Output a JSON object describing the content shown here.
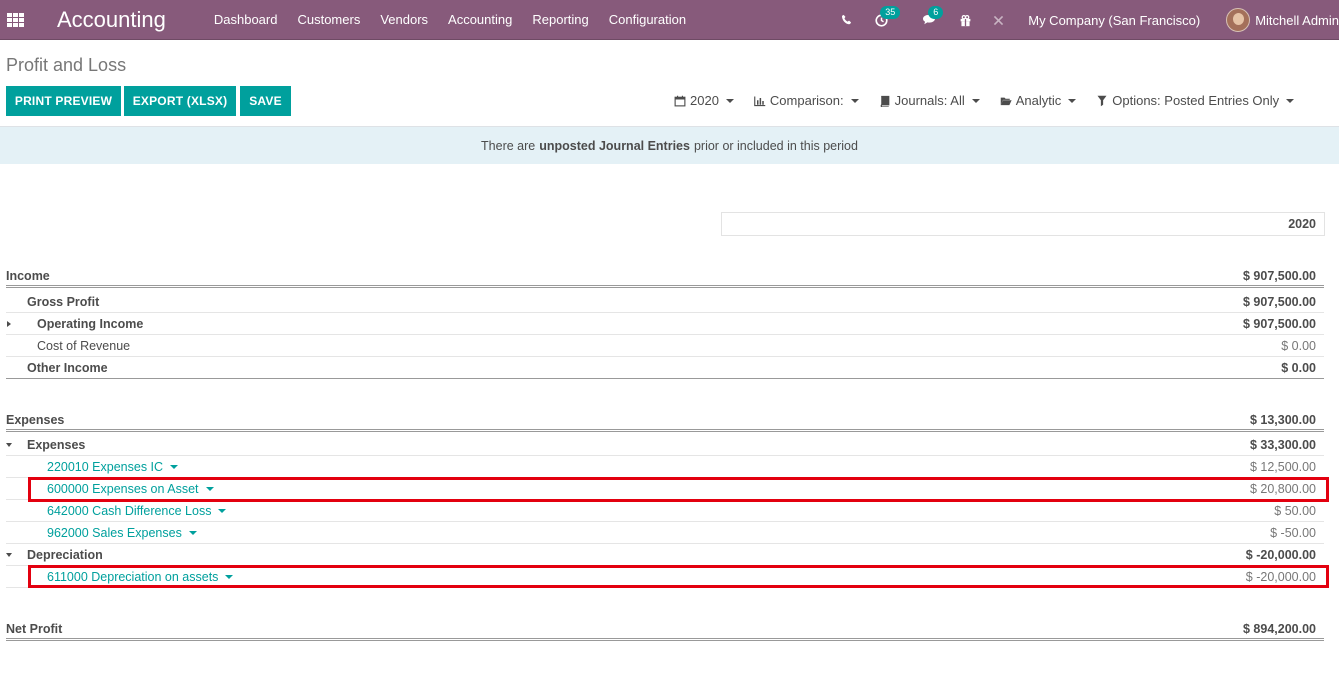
{
  "navbar": {
    "brand": "Accounting",
    "menu": [
      "Dashboard",
      "Customers",
      "Vendors",
      "Accounting",
      "Reporting",
      "Configuration"
    ],
    "activity_badge": "35",
    "messages_badge": "6",
    "company": "My Company (San Francisco)",
    "user": "Mitchell Admin"
  },
  "control_panel": {
    "title": "Profit and Loss",
    "buttons": {
      "print_preview": "PRINT PREVIEW",
      "export": "EXPORT (XLSX)",
      "save": "SAVE"
    },
    "filters": {
      "date": "2020",
      "comparison": "Comparison:",
      "journals": "Journals: All",
      "analytic": "Analytic",
      "options": "Options: Posted Entries Only"
    }
  },
  "alert": {
    "prefix": "There are",
    "strong": "unposted Journal Entries",
    "suffix": "prior or included in this period"
  },
  "report": {
    "column_header": "2020",
    "rows": {
      "income": {
        "label": "Income",
        "amount": "$ 907,500.00"
      },
      "gross_profit": {
        "label": "Gross Profit",
        "amount": "$ 907,500.00"
      },
      "operating_income": {
        "label": "Operating Income",
        "amount": "$ 907,500.00"
      },
      "cost_of_revenue": {
        "label": "Cost of Revenue",
        "amount": "$ 0.00"
      },
      "other_income": {
        "label": "Other Income",
        "amount": "$ 0.00"
      },
      "expenses_section": {
        "label": "Expenses",
        "amount": "$ 13,300.00"
      },
      "expenses": {
        "label": "Expenses",
        "amount": "$ 33,300.00"
      },
      "acc_220010": {
        "label": "220010 Expenses IC",
        "amount": "$ 12,500.00"
      },
      "acc_600000": {
        "label": "600000 Expenses on Asset",
        "amount": "$ 20,800.00"
      },
      "acc_642000": {
        "label": "642000 Cash Difference Loss",
        "amount": "$ 50.00"
      },
      "acc_962000": {
        "label": "962000 Sales Expenses",
        "amount": "$ -50.00"
      },
      "depreciation": {
        "label": "Depreciation",
        "amount": "$ -20,000.00"
      },
      "acc_611000": {
        "label": "611000 Depreciation on assets",
        "amount": "$ -20,000.00"
      },
      "net_profit": {
        "label": "Net Profit",
        "amount": "$ 894,200.00"
      }
    }
  },
  "colors": {
    "navbar": "#875a7b",
    "primary_button": "#00a09d",
    "link": "#00a09d",
    "alert_bg": "#e4f1f6",
    "highlight": "#e3000f"
  }
}
